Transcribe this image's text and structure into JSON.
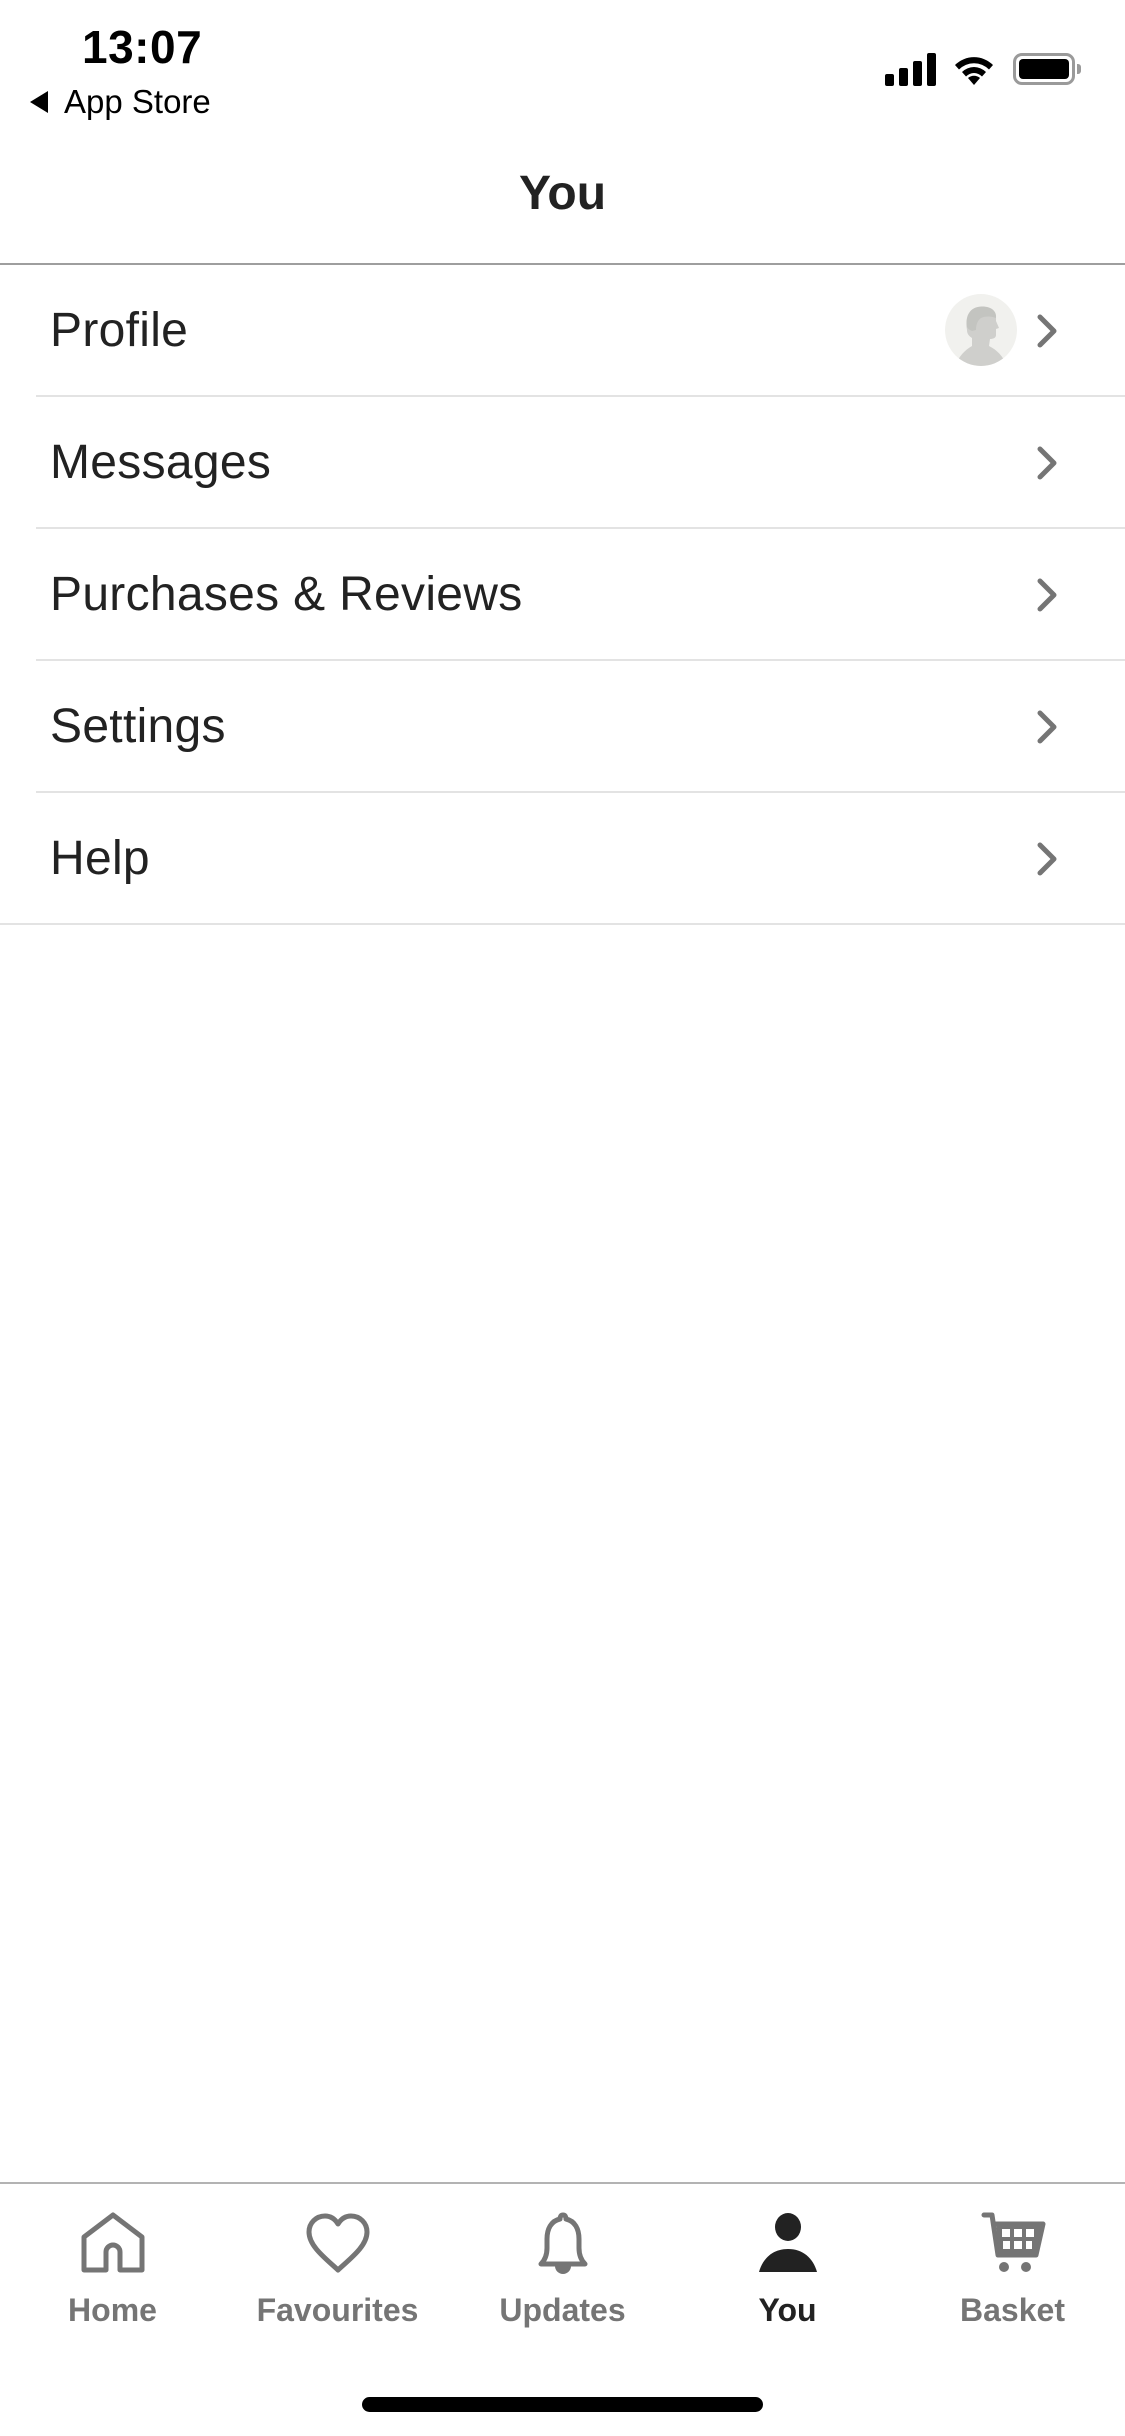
{
  "status_bar": {
    "time": "13:07",
    "back_app": "App Store",
    "icons": [
      "back-triangle-icon",
      "cellular-signal-icon",
      "wifi-icon",
      "battery-icon"
    ],
    "battery_level": 1.0
  },
  "header": {
    "title": "You"
  },
  "menu": {
    "items": [
      {
        "label": "Profile",
        "icon": "avatar-placeholder",
        "trailing": "chevron-right-icon"
      },
      {
        "label": "Messages",
        "trailing": "chevron-right-icon"
      },
      {
        "label": "Purchases & Reviews",
        "trailing": "chevron-right-icon"
      },
      {
        "label": "Settings",
        "trailing": "chevron-right-icon"
      },
      {
        "label": "Help",
        "trailing": "chevron-right-icon"
      }
    ]
  },
  "tab_bar": {
    "active": "You",
    "tabs": [
      {
        "label": "Home",
        "icon": "home-icon"
      },
      {
        "label": "Favourites",
        "icon": "heart-icon"
      },
      {
        "label": "Updates",
        "icon": "bell-icon"
      },
      {
        "label": "You",
        "icon": "person-icon"
      },
      {
        "label": "Basket",
        "icon": "cart-icon"
      }
    ]
  },
  "colors": {
    "text_primary": "#222222",
    "tab_inactive": "#757575",
    "tab_active": "#222222",
    "divider": "#e3e3e3",
    "header_border": "#9e9e9e",
    "chevron": "#757575",
    "avatar_bg": "#f1f1ee",
    "avatar_silhouette": "#cfcfcc"
  }
}
